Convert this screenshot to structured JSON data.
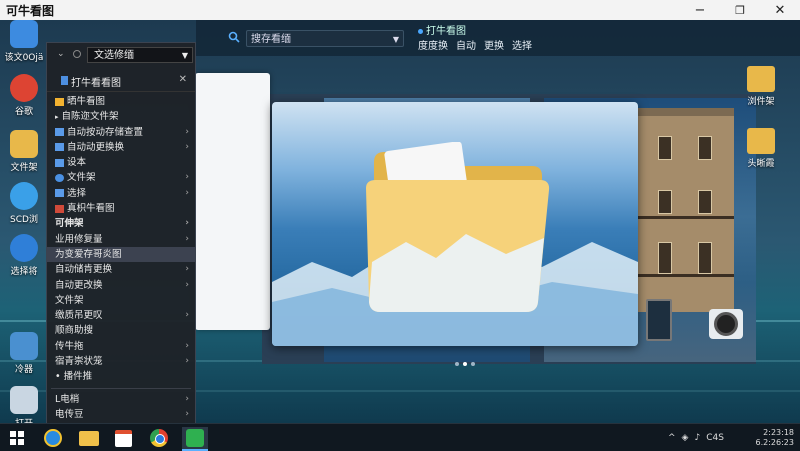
{
  "window": {
    "title": "可牛看图",
    "min_glyph": "−",
    "max_glyph": "❐",
    "close_glyph": "✕"
  },
  "desktop_icons_left": [
    {
      "label": "该文0Ojä",
      "icon": "app-icon",
      "color": "#3d8be0"
    },
    {
      "label": "谷歌",
      "icon": "chrome-icon",
      "color": "#dd4433"
    },
    {
      "label": "文件架",
      "icon": "folder-icon",
      "color": "#e8b84a"
    },
    {
      "label": "SCD浏",
      "icon": "ie-icon",
      "color": "#3aa0e8"
    },
    {
      "label": "选择将",
      "icon": "globe-icon",
      "color": "#2f7fd8"
    },
    {
      "label": "冷器",
      "icon": "person-icon",
      "color": "#4a90d0"
    },
    {
      "label": "打开",
      "icon": "document-icon",
      "color": "#c9d6e2"
    }
  ],
  "appbar": {
    "search_value": "搜存看缅",
    "title": "打牛看图",
    "actions": [
      "度度换",
      "自动",
      "更换",
      "选择"
    ]
  },
  "menu": {
    "combo_value": "文选修缅",
    "subheader": "打牛看看图",
    "items": [
      {
        "label": "晒牛看图",
        "kind": "star",
        "arrow": ""
      },
      {
        "label": "自陈迩文件架",
        "kind": "bullet",
        "arrow": ""
      },
      {
        "label": "自动按动存储查置",
        "kind": "folder",
        "arrow": "›"
      },
      {
        "label": "自动动更换换",
        "kind": "folder",
        "arrow": "›"
      },
      {
        "label": "设本",
        "kind": "folder",
        "arrow": ""
      },
      {
        "label": "文件架",
        "kind": "circle",
        "arrow": "›"
      },
      {
        "label": "选择",
        "kind": "folder",
        "arrow": "›"
      },
      {
        "label": "真枳牛看图",
        "kind": "app",
        "arrow": ""
      },
      {
        "label": "可伸架",
        "kind": "none",
        "arrow": "›",
        "bold": true
      },
      {
        "label": "业用修复量",
        "kind": "none",
        "arrow": "›"
      },
      {
        "label": "为变爱存哥炎图",
        "kind": "none",
        "arrow": "",
        "highlight": true
      },
      {
        "label": "自动储肯更换",
        "kind": "none",
        "arrow": "›"
      },
      {
        "label": "自动更改换",
        "kind": "none",
        "arrow": "›"
      },
      {
        "label": "文件架",
        "kind": "none",
        "arrow": ""
      },
      {
        "label": "缴质吊更叹",
        "kind": "none",
        "arrow": "›"
      },
      {
        "label": "顺商助搜",
        "kind": "none",
        "arrow": ""
      },
      {
        "label": "传牛拖",
        "kind": "none",
        "arrow": "›"
      },
      {
        "label": "宿青崇状笼",
        "kind": "none",
        "arrow": "›"
      },
      {
        "label": "• 播件推",
        "kind": "none",
        "arrow": ""
      }
    ],
    "footer": [
      {
        "label": "L电梢",
        "arrow": "›"
      },
      {
        "label": "电传豆",
        "arrow": "›"
      }
    ]
  },
  "desktop_icons_right": [
    {
      "label": "浏件架",
      "icon": "monitor-icon",
      "color": "#e8b84a"
    },
    {
      "label": "头晰霞",
      "icon": "folder-lock-icon",
      "color": "#e8b84a"
    }
  ],
  "taskbar": {
    "apps": [
      "windows-start-icon",
      "ie-icon",
      "file-explorer-icon",
      "store-icon",
      "chrome-icon",
      "viewer-app-icon"
    ],
    "tray_ime": "C4S",
    "time": "2:23:18",
    "date": "6.2:26:23"
  }
}
